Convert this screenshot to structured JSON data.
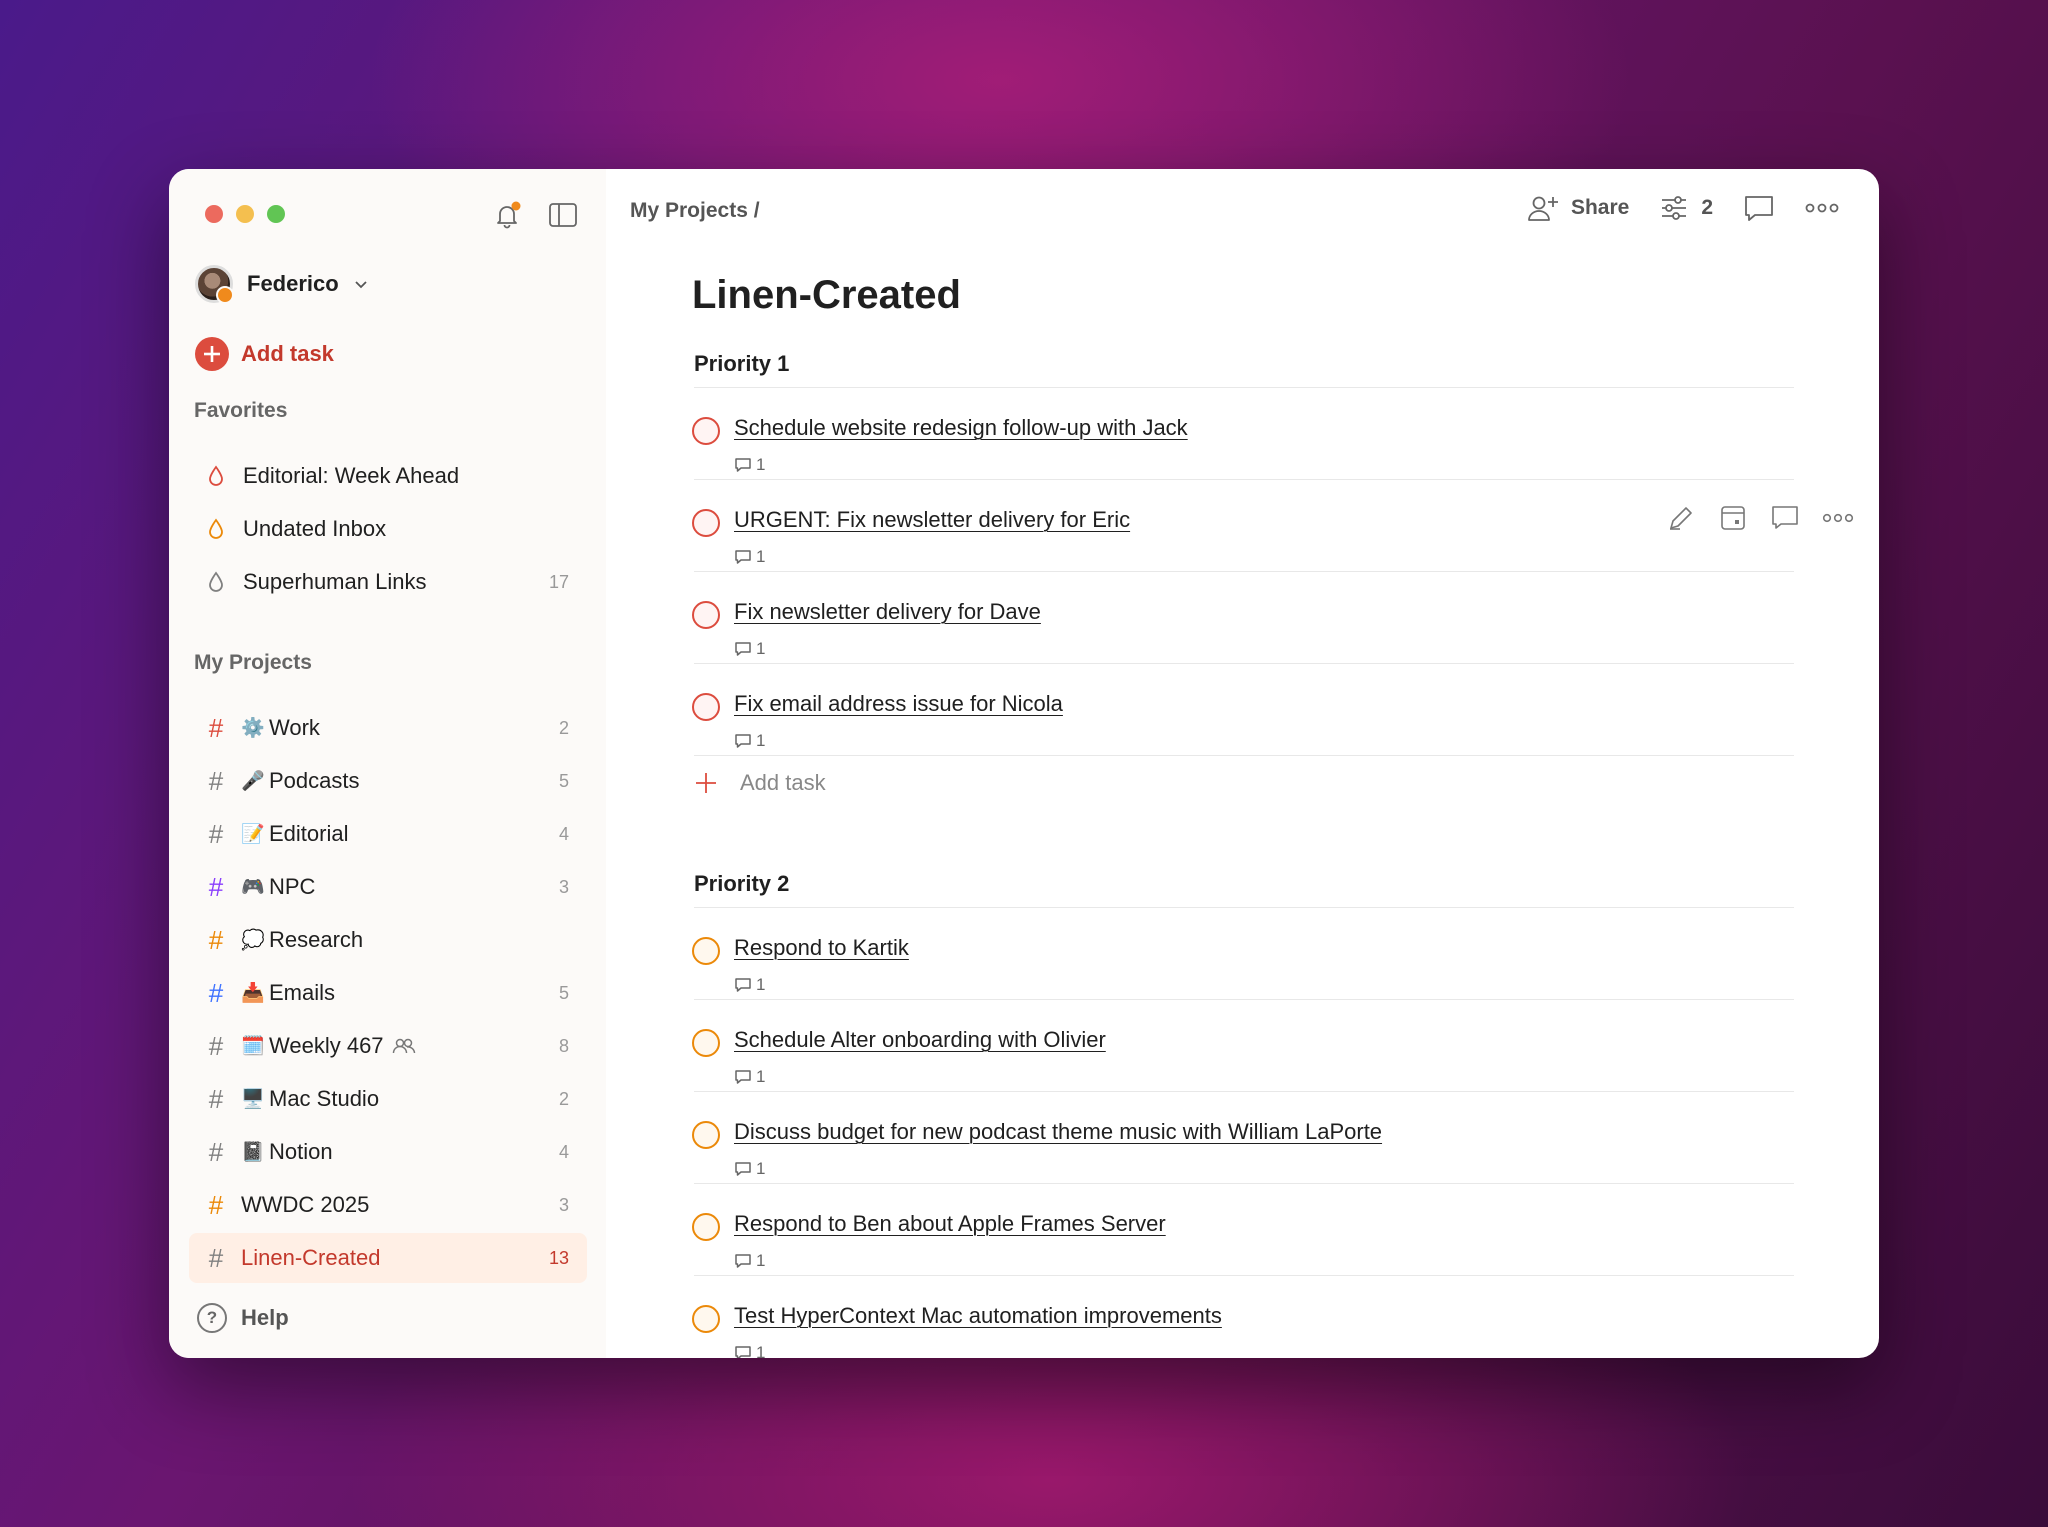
{
  "sidebar": {
    "user_name": "Federico",
    "add_task_label": "Add task",
    "favorites_title": "Favorites",
    "favorites": [
      {
        "label": "Editorial: Week Ahead",
        "count": "",
        "color": "#dc4c3e"
      },
      {
        "label": "Undated Inbox",
        "count": "",
        "color": "#eb8909"
      },
      {
        "label": "Superhuman Links",
        "count": "17",
        "color": "#808080"
      }
    ],
    "projects_title": "My Projects",
    "projects": [
      {
        "label": "Work",
        "emoji": "⚙️",
        "count": "2",
        "hash_color": "#dc4c3e"
      },
      {
        "label": "Podcasts",
        "emoji": "🎤",
        "count": "5",
        "hash_color": "#808080"
      },
      {
        "label": "Editorial",
        "emoji": "📝",
        "count": "4",
        "hash_color": "#808080"
      },
      {
        "label": "NPC",
        "emoji": "🎮",
        "count": "3",
        "hash_color": "#8a3ffc"
      },
      {
        "label": "Research",
        "emoji": "💭",
        "count": "",
        "hash_color": "#eb8909"
      },
      {
        "label": "Emails",
        "emoji": "📥",
        "count": "5",
        "hash_color": "#4073ff"
      },
      {
        "label": "Weekly 467",
        "emoji": "🗓️",
        "count": "8",
        "hash_color": "#808080"
      },
      {
        "label": "Mac Studio",
        "emoji": "🖥️",
        "count": "2",
        "hash_color": "#808080"
      },
      {
        "label": "Notion",
        "emoji": "📓",
        "count": "4",
        "hash_color": "#808080"
      },
      {
        "label": "WWDC 2025",
        "emoji": "",
        "count": "3",
        "hash_color": "#eb8909"
      },
      {
        "label": "Linen-Created",
        "emoji": "",
        "count": "13",
        "hash_color": "#808080"
      }
    ],
    "help_label": "Help"
  },
  "header": {
    "breadcrumb": "My Projects /",
    "share_label": "Share",
    "filter_count": "2"
  },
  "main": {
    "title": "Linen-Created",
    "groups": [
      {
        "title": "Priority 1",
        "tasks": [
          {
            "title": "Schedule website redesign follow-up with Jack",
            "comments": "1"
          },
          {
            "title": "URGENT: Fix newsletter delivery for Eric",
            "comments": "1"
          },
          {
            "title": "Fix newsletter delivery for Dave",
            "comments": "1"
          },
          {
            "title": "Fix email address issue for Nicola",
            "comments": "1"
          }
        ],
        "add_task_label": "Add task"
      },
      {
        "title": "Priority 2",
        "tasks": [
          {
            "title": "Respond to Kartik",
            "comments": "1"
          },
          {
            "title": "Schedule Alter onboarding with Olivier",
            "comments": "1"
          },
          {
            "title": "Discuss budget for new podcast theme music with William LaPorte",
            "comments": "1"
          },
          {
            "title": "Respond to Ben about Apple Frames Server",
            "comments": "1"
          },
          {
            "title": "Test HyperContext Mac automation improvements",
            "comments": "1"
          }
        ]
      }
    ]
  }
}
